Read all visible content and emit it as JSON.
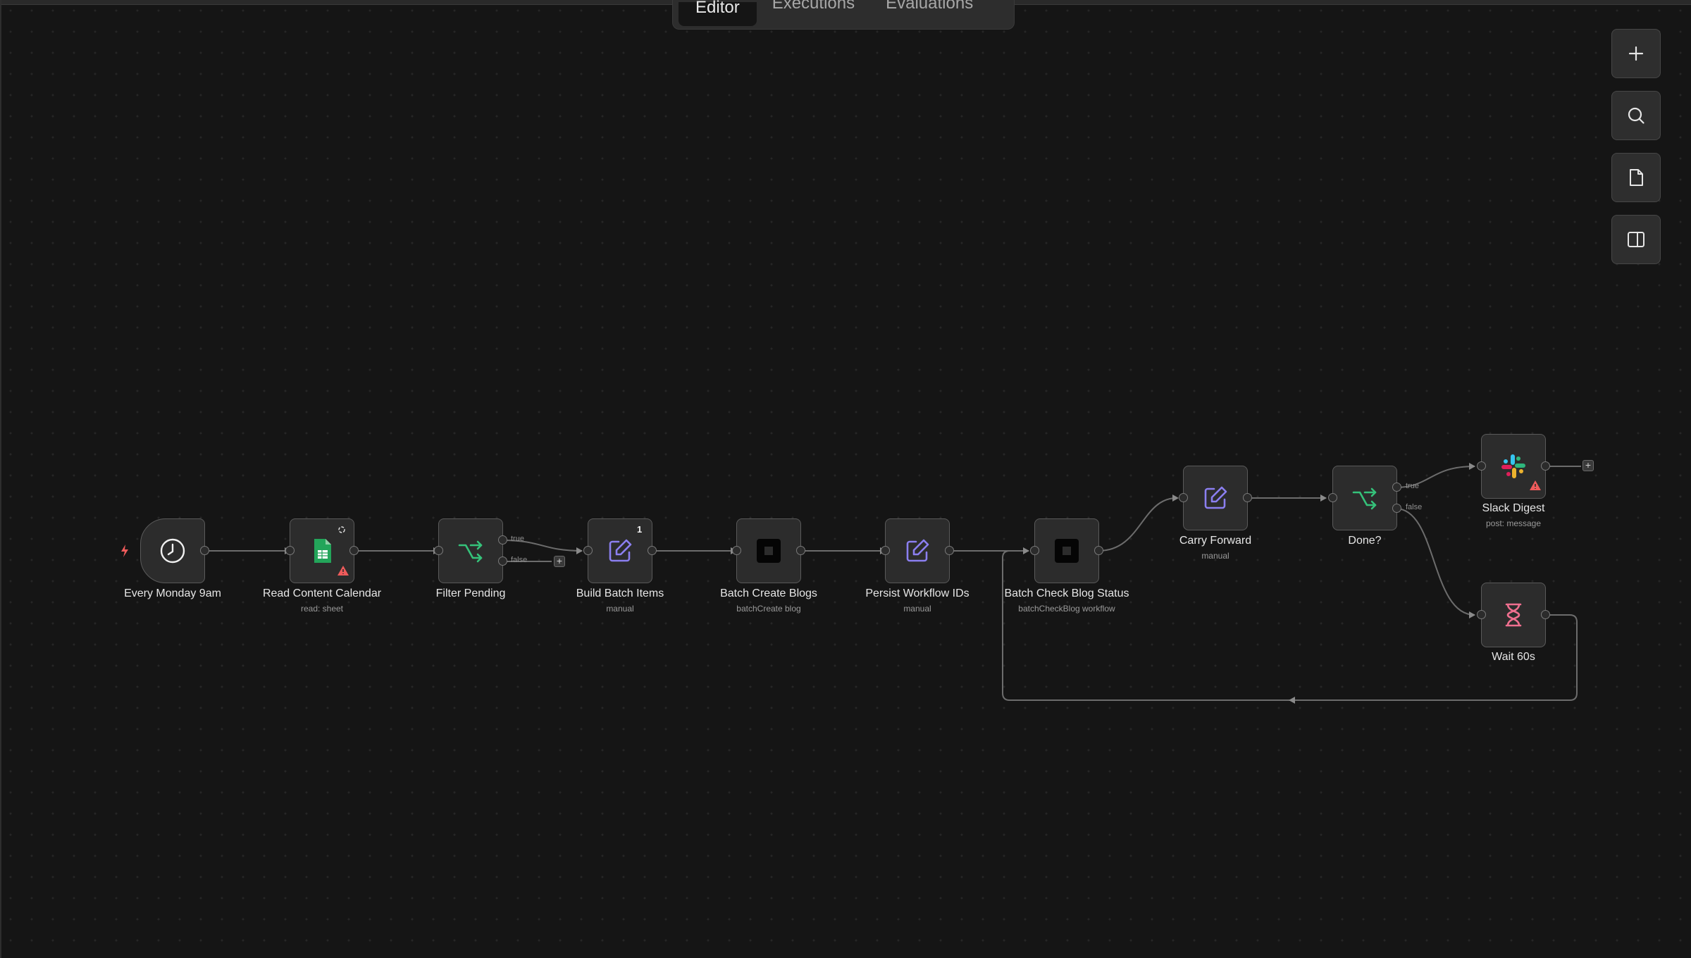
{
  "tabs": [
    {
      "label": "Editor",
      "active": true
    },
    {
      "label": "Executions",
      "active": false
    },
    {
      "label": "Evaluations",
      "active": false
    }
  ],
  "toolbar": {
    "add": "plus-icon",
    "search": "search-icon",
    "sticky": "note-icon",
    "panel": "sidebar-panel-icon"
  },
  "nodes": [
    {
      "id": "every-monday",
      "label": "Every Monday 9am",
      "sub": "",
      "icon": "clock-icon"
    },
    {
      "id": "read-calendar",
      "label": "Read Content Calendar",
      "sub": "read: sheet",
      "icon": "google-sheets-icon",
      "warning": true
    },
    {
      "id": "filter-pending",
      "label": "Filter Pending",
      "sub": "",
      "icon": "branch-icon",
      "branches": [
        "true",
        "false"
      ]
    },
    {
      "id": "build-batch",
      "label": "Build Batch Items",
      "sub": "manual",
      "icon": "edit-icon",
      "badge": "1"
    },
    {
      "id": "batch-create",
      "label": "Batch Create Blogs",
      "sub": "batchCreate blog",
      "icon": "square-icon"
    },
    {
      "id": "persist-ids",
      "label": "Persist Workflow IDs",
      "sub": "manual",
      "icon": "edit-icon"
    },
    {
      "id": "batch-check",
      "label": "Batch Check Blog Status",
      "sub": "batchCheckBlog workflow",
      "icon": "square-icon"
    },
    {
      "id": "carry-forward",
      "label": "Carry Forward",
      "sub": "manual",
      "icon": "edit-icon"
    },
    {
      "id": "done",
      "label": "Done?",
      "sub": "",
      "icon": "branch-icon",
      "branches": [
        "true",
        "false"
      ]
    },
    {
      "id": "slack-digest",
      "label": "Slack Digest",
      "sub": "post: message",
      "icon": "slack-icon",
      "warning": true
    },
    {
      "id": "wait-60s",
      "label": "Wait 60s",
      "sub": "",
      "icon": "hourglass-icon"
    }
  ],
  "colors": {
    "background": "#151515",
    "node": "#2c2c2c",
    "edit_icon": "#8b7ff0",
    "branch_icon": "#35c27a",
    "wait_icon": "#ef6f8f",
    "warning": "#ef5b5b",
    "sheets": "#23a55a"
  }
}
